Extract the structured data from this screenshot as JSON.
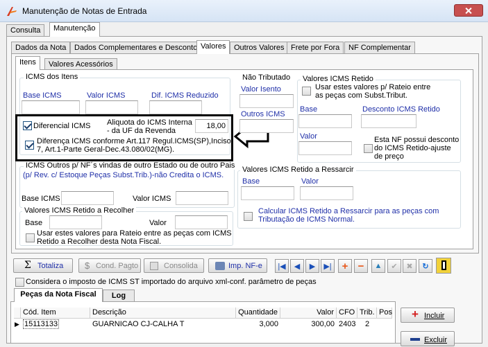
{
  "window": {
    "title": "Manutenção de Notas de Entrada"
  },
  "main_tabs": [
    "Consulta",
    "Manutenção"
  ],
  "sub_tabs": [
    "Dados da Nota",
    "Dados Complementares e Desconto",
    "Valores",
    "Outros Valores",
    "Frete por Fora",
    "NF Complementar"
  ],
  "inner_tabs": [
    "Itens",
    "Valores Acessórios"
  ],
  "icms_itens": {
    "title": "ICMS dos Itens",
    "base_label": "Base ICMS",
    "valor_label": "Valor ICMS",
    "dif_label": "Dif. ICMS Reduzido",
    "diferencial_label": "Diferencial ICMS",
    "aliquota_label_1": "Aliquota do ICMS Interna",
    "aliquota_label_2": "- da UF da Revenda",
    "aliquota_value": "18,00",
    "diferenca_label_1": "Diferença ICMS conforme Art.117 Regul.ICMS(SP),Inciso",
    "diferenca_label_2": "7, Art.1-Parte Geral-Dec.43.080/02(MG)."
  },
  "nao_tributado": {
    "title": "Não Tributado",
    "valor_isento_label": "Valor Isento",
    "outros_icms_label": "Outros ICMS"
  },
  "icms_retido": {
    "title": "Valores ICMS Retido",
    "rateio_label_1": "Usar estes valores p/ Rateio  entre",
    "rateio_label_2": "as peças com Subst.Tribut.",
    "base_label": "Base",
    "desconto_label": "Desconto ICMS Retido",
    "valor_label": "Valor",
    "nf_desconto_1": "Esta NF possui desconto",
    "nf_desconto_2": "do ICMS Retido-ajuste",
    "nf_desconto_3": "de preço"
  },
  "icms_outros": {
    "title": "ICMS Outros p/ NF´s vindas de outro Estado ou de outro Pais",
    "subtitle": "(p/ Rev. c/ Estoque Peças Subst.Trib.)-não Credita o ICMS.",
    "base_label": "Base ICMS",
    "valor_label": "Valor ICMS"
  },
  "retido_recolher": {
    "title": "Valores ICMS Retido a Recolher",
    "base_label": "Base",
    "valor_label": "Valor",
    "rateio_label_1": "Usar estes valores para Rateio entre as peças com ICMS",
    "rateio_label_2": "Retido a Recolher desta Nota Fiscal."
  },
  "retido_ressarcir": {
    "title": "Valores ICMS Retido a Ressarcir",
    "base_label": "Base",
    "valor_label": "Valor",
    "calc_label_1": "Calcular ICMS Retido a  Ressarcir para as peças com",
    "calc_label_2": "Tributação de ICMS Normal."
  },
  "toolbar": {
    "totaliza": "Totaliza",
    "cond_pagto": "Cond. Pagto",
    "consolida": "Consolida",
    "imp_nfe": "Imp. NF-e"
  },
  "considera_label": "Considera o imposto de ICMS ST importado do arquivo xml-conf. parâmetro de peças",
  "bottom_tabs": [
    "Peças da Nota Fiscal",
    "Log"
  ],
  "grid": {
    "columns": [
      "Cód. Item",
      "Descrição",
      "Quantidade",
      "Valor",
      "CFO",
      "Trib.",
      "Pos"
    ],
    "rows": [
      {
        "cod": "15113133",
        "descricao": "GUARNICAO CJ-CALHA T",
        "quantidade": "3,000",
        "valor": "300,00",
        "cfo": "2403",
        "trib": "2",
        "pos": ""
      }
    ]
  },
  "buttons": {
    "incluir": "Incluir",
    "excluir": "Excluir"
  }
}
